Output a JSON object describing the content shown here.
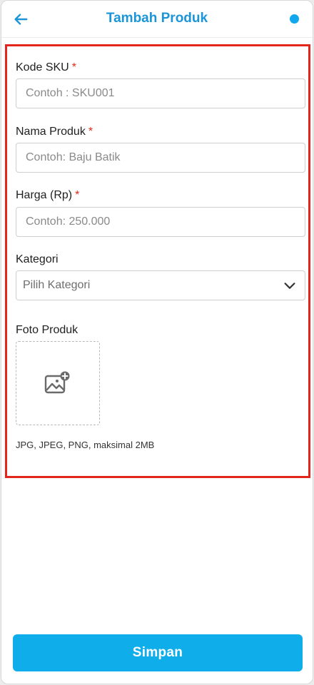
{
  "header": {
    "title": "Tambah Produk",
    "back_icon": "arrow-left-icon",
    "status_color": "#10a7ec"
  },
  "form": {
    "sku": {
      "label": "Kode SKU",
      "required_mark": "*",
      "placeholder": "Contoh : SKU001",
      "value": ""
    },
    "name": {
      "label": "Nama Produk",
      "required_mark": "*",
      "placeholder": "Contoh: Baju Batik",
      "value": ""
    },
    "price": {
      "label": "Harga (Rp)",
      "required_mark": "*",
      "placeholder": "Contoh: 250.000",
      "value": ""
    },
    "category": {
      "label": "Kategori",
      "selected": "Pilih Kategori",
      "icon": "chevron-down-icon"
    },
    "photo": {
      "label": "Foto Produk",
      "icon": "add-image-icon",
      "hint": "JPG, JPEG, PNG, maksimal 2MB"
    }
  },
  "actions": {
    "save_label": "Simpan"
  },
  "colors": {
    "accent": "#0faeea",
    "title": "#1b95d8",
    "required": "#e2261c",
    "highlight_border": "#e2261c"
  }
}
